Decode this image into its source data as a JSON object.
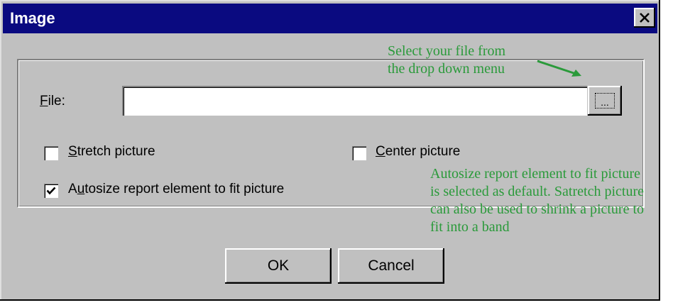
{
  "dialog": {
    "title": "Image",
    "close_icon": "close-x-icon"
  },
  "file": {
    "label_prefix": "",
    "label_mnemonic": "F",
    "label_rest": "ile:",
    "value": "",
    "browse_label": "...",
    "browse_icon": "ellipsis-icon"
  },
  "options": {
    "stretch": {
      "mnemonic": "S",
      "rest": "tretch picture",
      "checked": false
    },
    "center": {
      "mnemonic": "C",
      "rest": "enter picture",
      "checked": false
    },
    "autosize": {
      "prefix": "A",
      "mnemonic": "u",
      "rest": "tosize report element to fit picture",
      "checked": true
    }
  },
  "buttons": {
    "ok": "OK",
    "cancel": "Cancel"
  },
  "annotations": {
    "file_note_line1": "Select your file from",
    "file_note_line2": "the drop down menu",
    "autosize_note_line1": "Autosize report element to fit picture",
    "autosize_note_line2": "is selected as default. Satretch picture",
    "autosize_note_line3": "can also be used to shrink a picture to",
    "autosize_note_line4": "fit into a band",
    "color": "#2a9a3a"
  },
  "colors": {
    "face": "#c0c0c0",
    "titlebar": "#0a0a80",
    "title_text": "#ffffff"
  }
}
